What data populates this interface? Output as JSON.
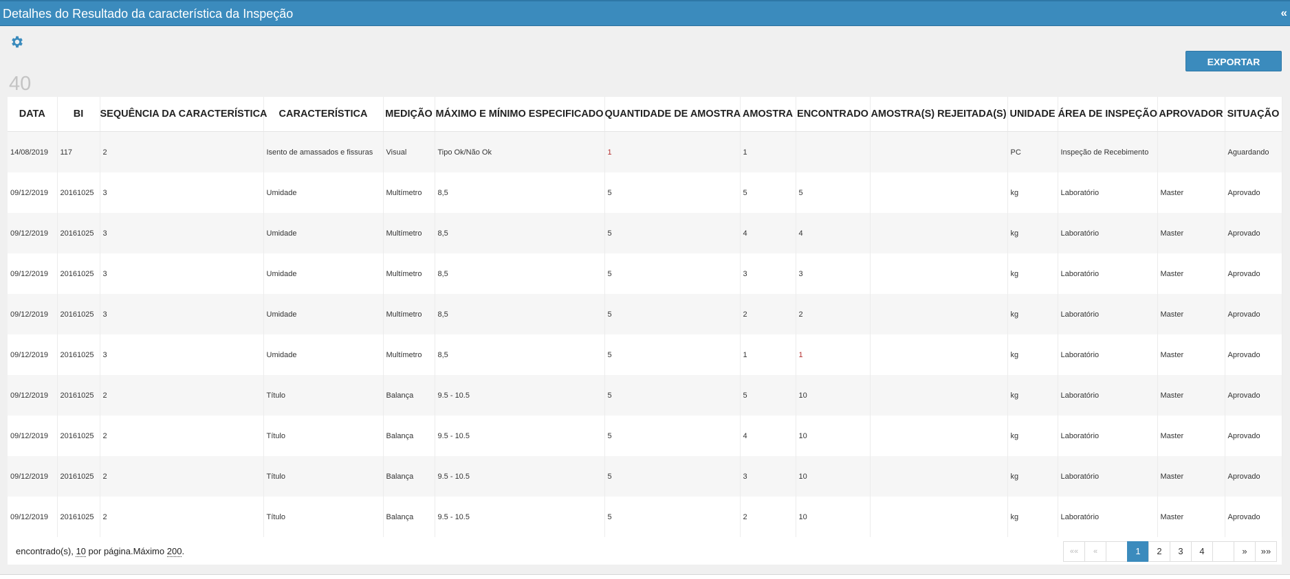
{
  "header": {
    "title": "Detalhes do Resultado da característica da Inspeção",
    "collapse_label": "«"
  },
  "toolbar": {
    "settings_icon": "gear-icon",
    "export_label": "EXPORTAR"
  },
  "record_count": "40",
  "table": {
    "columns": [
      "DATA",
      "BI",
      "SEQUÊNCIA DA CARACTERÍSTICA",
      "CARACTERÍSTICA",
      "MEDIÇÃO",
      "MÁXIMO E MÍNIMO ESPECIFICADO",
      "QUANTIDADE DE AMOSTRA",
      "AMOSTRA",
      "ENCONTRADO",
      "AMOSTRA(S) REJEITADA(S)",
      "UNIDADE",
      "ÁREA DE INSPEÇÃO",
      "APROVADOR",
      "SITUAÇÃO"
    ],
    "rows": [
      [
        "14/08/2019",
        "117",
        "2",
        "Isento de amassados e fissuras",
        "Visual",
        "Tipo Ok/Não Ok",
        "1",
        "1",
        "",
        "",
        "PC",
        "Inspeção de Recebimento",
        "",
        "Aguardando"
      ],
      [
        "09/12/2019",
        "20161025",
        "3",
        "Umidade",
        "Multímetro",
        "8,5",
        "5",
        "5",
        "5",
        "",
        "kg",
        "Laboratório",
        "Master",
        "Aprovado"
      ],
      [
        "09/12/2019",
        "20161025",
        "3",
        "Umidade",
        "Multímetro",
        "8,5",
        "5",
        "4",
        "4",
        "",
        "kg",
        "Laboratório",
        "Master",
        "Aprovado"
      ],
      [
        "09/12/2019",
        "20161025",
        "3",
        "Umidade",
        "Multímetro",
        "8,5",
        "5",
        "3",
        "3",
        "",
        "kg",
        "Laboratório",
        "Master",
        "Aprovado"
      ],
      [
        "09/12/2019",
        "20161025",
        "3",
        "Umidade",
        "Multímetro",
        "8,5",
        "5",
        "2",
        "2",
        "",
        "kg",
        "Laboratório",
        "Master",
        "Aprovado"
      ],
      [
        "09/12/2019",
        "20161025",
        "3",
        "Umidade",
        "Multímetro",
        "8,5",
        "5",
        "1",
        "1",
        "",
        "kg",
        "Laboratório",
        "Master",
        "Aprovado"
      ],
      [
        "09/12/2019",
        "20161025",
        "2",
        "Título",
        "Balança",
        "9.5 - 10.5",
        "5",
        "5",
        "10",
        "",
        "kg",
        "Laboratório",
        "Master",
        "Aprovado"
      ],
      [
        "09/12/2019",
        "20161025",
        "2",
        "Título",
        "Balança",
        "9.5 - 10.5",
        "5",
        "4",
        "10",
        "",
        "kg",
        "Laboratório",
        "Master",
        "Aprovado"
      ],
      [
        "09/12/2019",
        "20161025",
        "2",
        "Título",
        "Balança",
        "9.5 - 10.5",
        "5",
        "3",
        "10",
        "",
        "kg",
        "Laboratório",
        "Master",
        "Aprovado"
      ],
      [
        "09/12/2019",
        "20161025",
        "2",
        "Título",
        "Balança",
        "9.5 - 10.5",
        "5",
        "2",
        "10",
        "",
        "kg",
        "Laboratório",
        "Master",
        "Aprovado"
      ]
    ]
  },
  "footer": {
    "found_label": "encontrado(s),",
    "per_page": "10",
    "per_page_label": "por página.Máximo",
    "max": "200",
    "max_suffix": "."
  },
  "pagination": {
    "first": "««",
    "prev": "«",
    "pages": [
      "1",
      "2",
      "3",
      "4"
    ],
    "next": "»",
    "last": "»»",
    "current": "1"
  },
  "colors": {
    "accent": "#3b8bbd",
    "highlight_text": "#b32d2d"
  }
}
